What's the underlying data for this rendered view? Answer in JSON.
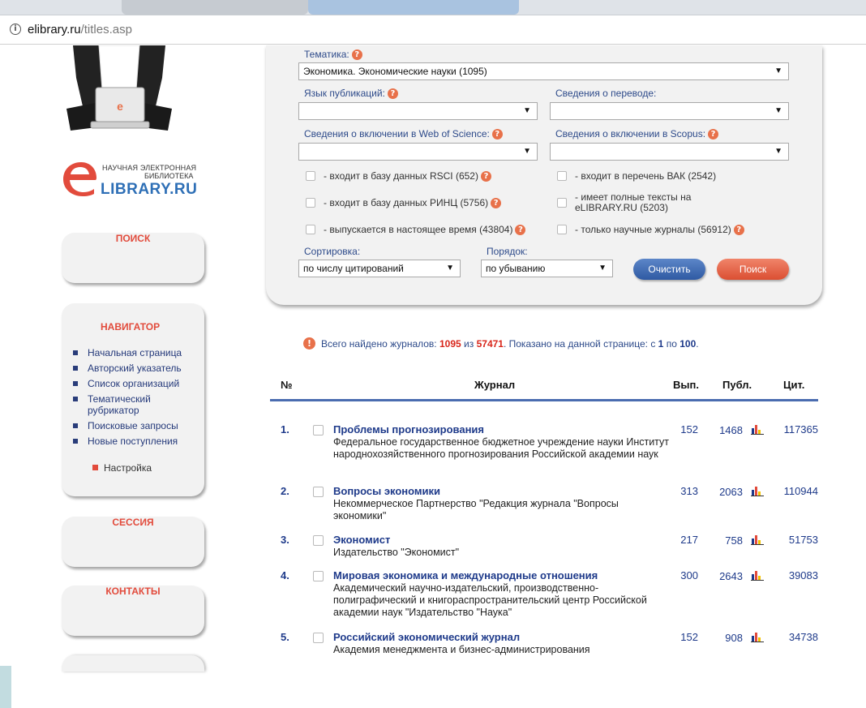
{
  "browser": {
    "url_host": "elibrary.ru",
    "url_path": "/titles.asp"
  },
  "logo": {
    "line1": "НАУЧНАЯ ЭЛЕКТРОННАЯ",
    "line2": "БИБЛИОТЕКА",
    "line3": "LIBRARY.RU",
    "laptop_letter": "e"
  },
  "sidebar": {
    "search_label": "ПОИСК",
    "navigator_title": "НАВИГАТОР",
    "nav_items": [
      "Начальная страница",
      "Авторский указатель",
      "Список организаций",
      "Тематический рубрикатор",
      "Поисковые запросы",
      "Новые поступления"
    ],
    "settings_label": "Настройка",
    "session_label": "СЕССИЯ",
    "contacts_label": "КОНТАКТЫ"
  },
  "filters": {
    "topic_label": "Тематика:",
    "topic_value": "Экономика. Экономические науки  (1095)",
    "language_label": "Язык публикаций:",
    "language_value": "",
    "translation_label": "Сведения о переводе:",
    "translation_value": "",
    "wos_label": "Сведения о включении в Web of Science:",
    "wos_value": "",
    "scopus_label": "Сведения о включении в Scopus:",
    "scopus_value": "",
    "checkboxes": {
      "rsci": "- входит в базу данных RSCI (652)",
      "vak": "- входит в перечень ВАК (2542)",
      "rinc": "- входит в базу данных РИНЦ (5756)",
      "fulltext": "- имеет полные тексты на eLIBRARY.RU (5203)",
      "current": "- выпускается в настоящее время (43804)",
      "scientific": "- только научные журналы (56912)"
    },
    "sort_label": "Сортировка:",
    "sort_value": "по числу цитирований",
    "order_label": "Порядок:",
    "order_value": "по убыванию",
    "clear_button": "Очистить",
    "search_button": "Поиск"
  },
  "summary": {
    "prefix": "Всего найдено журналов:",
    "found": "1095",
    "of": "из",
    "total": "57471",
    "shown_prefix": ". Показано на данной странице: с",
    "from": "1",
    "to_word": "по",
    "to": "100",
    "end": "."
  },
  "table": {
    "headers": {
      "num": "№",
      "journal": "Журнал",
      "issues": "Вып.",
      "publications": "Публ.",
      "citations": "Цит."
    },
    "rows": [
      {
        "num": "1.",
        "title": "Проблемы прогнозирования",
        "publisher": "Федеральное государственное бюджетное учреждение науки Институт народнохозяйственного прогнозирования Российской академии наук",
        "issues": "152",
        "publications": "1468",
        "citations": "117365"
      },
      {
        "num": "2.",
        "title": "Вопросы экономики",
        "publisher": "Некоммерческое Партнерство \"Редакция журнала \"Вопросы экономики\"",
        "issues": "313",
        "publications": "2063",
        "citations": "110944"
      },
      {
        "num": "3.",
        "title": "Экономист",
        "publisher": "Издательство \"Экономист\"",
        "issues": "217",
        "publications": "758",
        "citations": "51753"
      },
      {
        "num": "4.",
        "title": "Мировая экономика и международные отношения",
        "publisher": "Академический научно-издательский, производственно-полиграфический и книгораспространительский центр Российской академии наук \"Издательство \"Наука\"",
        "issues": "300",
        "publications": "2643",
        "citations": "39083"
      },
      {
        "num": "5.",
        "title": "Российский экономический журнал",
        "publisher": "Академия менеджмента и бизнес-администрирования",
        "issues": "152",
        "publications": "908",
        "citations": "34738"
      }
    ]
  },
  "colors": {
    "accent_red": "#e24b3c",
    "link_blue": "#1e3a8a",
    "header_line": "#4a6cb0"
  },
  "icons": {
    "help": "question-icon",
    "stats": "bar-chart-icon",
    "info": "info-icon"
  }
}
